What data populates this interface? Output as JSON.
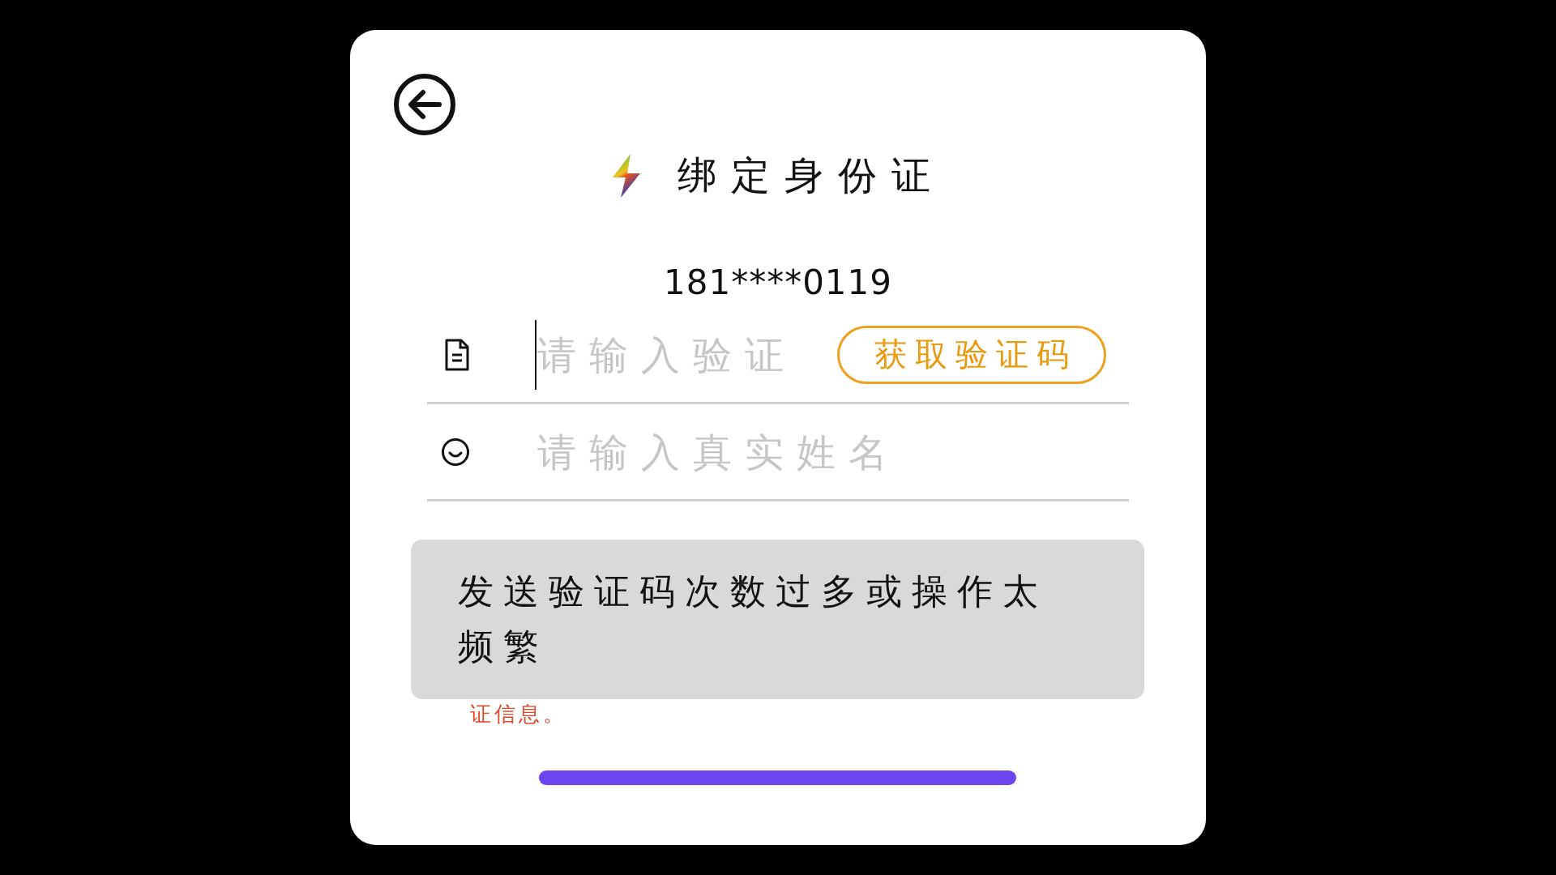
{
  "title": "绑定身份证",
  "phone": "181****0119",
  "fields": [
    {
      "kind": "code",
      "placeholder": "请输入验证",
      "focused": true,
      "button": "获取验证码"
    },
    {
      "kind": "name",
      "placeholder": "请输入真实姓名",
      "focused": false
    }
  ],
  "notice": "证信息。",
  "toast": "发送验证码次数过多或操作太频繁"
}
